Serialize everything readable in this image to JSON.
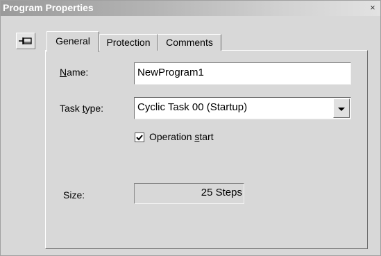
{
  "window": {
    "title": "Program Properties",
    "close_glyph": "×"
  },
  "icons": {
    "pin": "pin-icon",
    "close": "close-icon",
    "dropdown": "chevron-down-icon",
    "check": "checkmark-icon"
  },
  "tabs": [
    {
      "label": "General",
      "active": true
    },
    {
      "label": "Protection",
      "active": false
    },
    {
      "label": "Comments",
      "active": false
    }
  ],
  "general": {
    "name_label_accel": "N",
    "name_label_rest": "ame:",
    "name_value": "NewProgram1",
    "tasktype_label_pre": "Task ",
    "tasktype_label_accel": "t",
    "tasktype_label_post": "ype:",
    "tasktype_value": "Cyclic Task 00 (Startup)",
    "operation_start_checked": true,
    "operation_start_label_pre": "Operation ",
    "operation_start_label_accel": "s",
    "operation_start_label_post": "tart",
    "size_label": "Size:",
    "size_value": "25 Steps"
  }
}
